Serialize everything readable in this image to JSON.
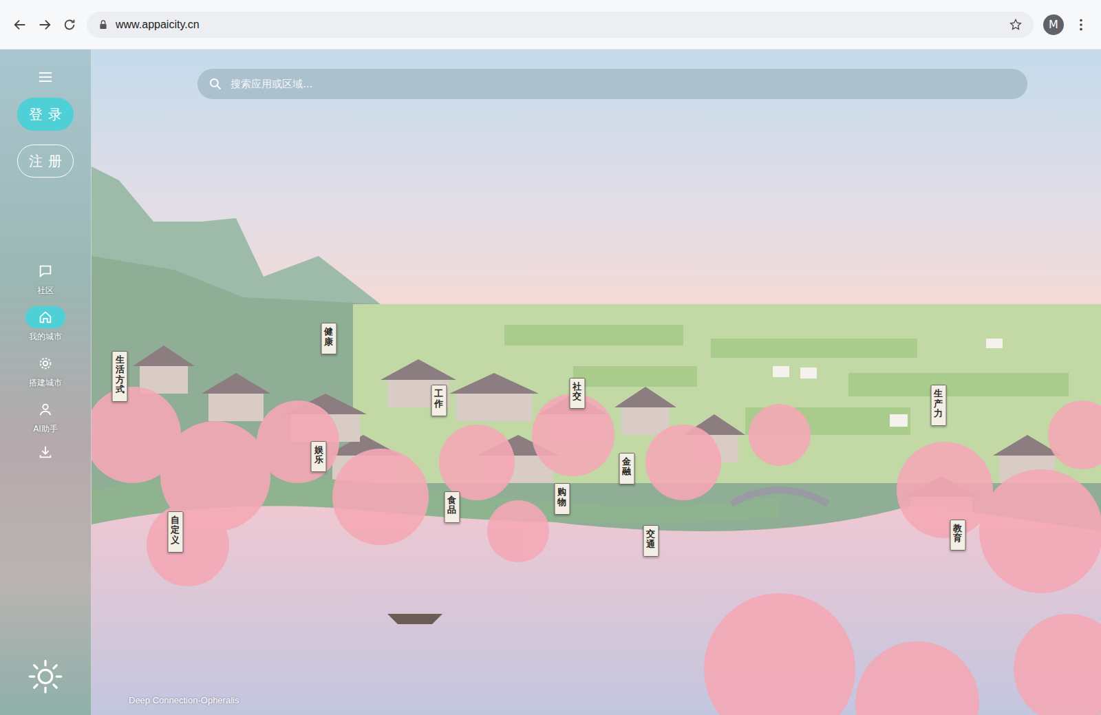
{
  "browser": {
    "url": "www.appaicity.cn",
    "profile": "M"
  },
  "sidebar": {
    "auth_buttons": [
      {
        "label": "登录",
        "kind": "primary"
      },
      {
        "label": "注册",
        "kind": "outline"
      }
    ],
    "nav": [
      {
        "label": "社区",
        "selected": false
      },
      {
        "label": "我的城市",
        "selected": true
      },
      {
        "label": "搭建城市",
        "selected": false
      },
      {
        "label": "AI助手",
        "selected": false
      }
    ]
  },
  "search": {
    "placeholder": "搜索应用或区域..."
  },
  "districts": [
    {
      "label": "生活方式"
    },
    {
      "label": "健康"
    },
    {
      "label": "工作"
    },
    {
      "label": "社交"
    },
    {
      "label": "娱乐"
    },
    {
      "label": "金融"
    },
    {
      "label": "食品"
    },
    {
      "label": "购物"
    },
    {
      "label": "自定义"
    },
    {
      "label": "交通"
    },
    {
      "label": "生产力"
    },
    {
      "label": "教育"
    }
  ],
  "footer": {
    "credit": "Deep Connection-Opheralis"
  }
}
